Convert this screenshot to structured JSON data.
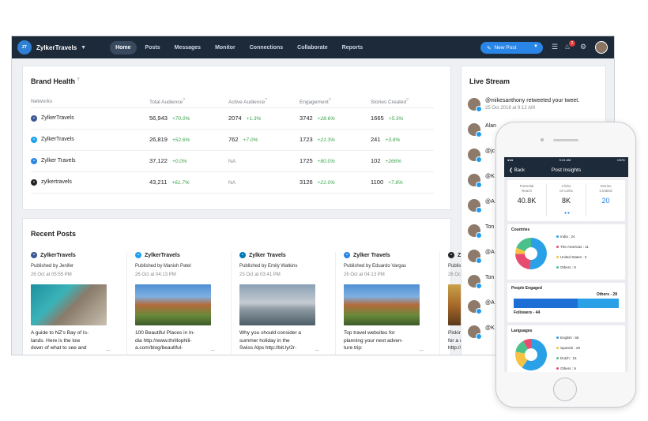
{
  "topbar": {
    "brand": "ZylkerTravels",
    "logo_text": "Zylker Travels",
    "nav": [
      "Home",
      "Posts",
      "Messages",
      "Monitor",
      "Connections",
      "Collaborate",
      "Reports"
    ],
    "active_nav": "Home",
    "new_post_label": "New Post",
    "notification_count": "2"
  },
  "brand_health": {
    "title": "Brand Health",
    "columns": [
      "Networks",
      "Total Audience",
      "Active Audience",
      "Engagement",
      "Stories Created"
    ],
    "rows": [
      {
        "network": "ZylkerTravels",
        "icon": "facebook-icon",
        "color": "#3b5998",
        "total": "56,943",
        "total_pct": "+70.0%",
        "active": "2074",
        "active_pct": "+1.3%",
        "eng": "3742",
        "eng_pct": "+28.6%",
        "stories": "1665",
        "stories_pct": "+5.3%"
      },
      {
        "network": "ZylkerTravels",
        "icon": "twitter-icon",
        "color": "#1da1f2",
        "total": "26,819",
        "total_pct": "+52.6%",
        "active": "762",
        "active_pct": "+7.0%",
        "eng": "1723",
        "eng_pct": "+21.3%",
        "stories": "241",
        "stories_pct": "+3.8%"
      },
      {
        "network": "Zylker Travels",
        "icon": "business-icon",
        "color": "#2a86e6",
        "total": "37,122",
        "total_pct": "+0.0%",
        "active": "NA",
        "active_pct": "",
        "eng": "1725",
        "eng_pct": "+80.0%",
        "stories": "102",
        "stories_pct": "+266%"
      },
      {
        "network": "zylkertravels",
        "icon": "instagram-icon",
        "color": "#222222",
        "total": "43,211",
        "total_pct": "+61.7%",
        "active": "NA",
        "active_pct": "",
        "eng": "3126",
        "eng_pct": "+21.0%",
        "stories": "1100",
        "stories_pct": "+7.8%"
      }
    ]
  },
  "recent_posts": {
    "title": "Recent Posts",
    "posts": [
      {
        "account": "ZylkerTravels",
        "icon": "facebook-icon",
        "color": "#3b5998",
        "published_by": "Published by Jenifer",
        "date": "26 Oct at 05:55 PM",
        "text": "A guide to NZ's Bay of Is-\nlands. Here is the low\ndown of what to see and",
        "img": "aerial"
      },
      {
        "account": "ZylkerTravels",
        "icon": "twitter-icon",
        "color": "#1da1f2",
        "published_by": "Published by Manish Patel",
        "date": "26 Oct at 04:13 PM",
        "text": "100 Beautiful Places in In-\ndia http://www.thrillophili-\na.com/blog/beautiful-",
        "img": "mountain"
      },
      {
        "account": "Zylker Travels",
        "icon": "linkedin-icon",
        "color": "#0077b5",
        "published_by": "Published by Emily Watkins",
        "date": "23 Oct at 03:41 PM",
        "text": "Why you should consider a\nsummer holiday in the\nSwiss Alps http://bit.ly/2r-",
        "img": "taj"
      },
      {
        "account": "Zylker Travels",
        "icon": "business-icon",
        "color": "#2a86e6",
        "published_by": "Published by Eduardo Vargas",
        "date": "26 Oct at 04:13 PM",
        "text": "Top travel websites for\nplanning your next adven-\nture trip:",
        "img": "mountain"
      },
      {
        "account": "Zylker T",
        "icon": "instagram-icon",
        "color": "#222222",
        "published_by": "Published by",
        "date": "26 Oct at",
        "text": "Picking the\nfor a classic\nhttp://bit.ly",
        "img": "forest"
      }
    ]
  },
  "live_stream": {
    "title": "Live Stream",
    "items": [
      {
        "text": "@mikesanthony retweeted your tweet.",
        "date": "25 Oct 2018 at 9:12 AM"
      },
      {
        "text": "Alan",
        "date": ""
      },
      {
        "text": "@jc",
        "date": ""
      },
      {
        "text": "@K",
        "date": ""
      },
      {
        "text": "@A",
        "date": ""
      },
      {
        "text": "Ton",
        "date": ""
      },
      {
        "text": "@A",
        "date": ""
      },
      {
        "text": "Ton",
        "date": ""
      },
      {
        "text": "@A",
        "date": ""
      },
      {
        "text": "@K",
        "date": ""
      }
    ]
  },
  "phone": {
    "status_time": "9:41 AM",
    "status_battery": "100%",
    "back_label": "Back",
    "title": "Post Insights",
    "metrics": [
      {
        "label": "Potential\nReach",
        "value": "40.8K"
      },
      {
        "label": "Clicks\non Links",
        "value": "8K"
      },
      {
        "label": "Stories\nCreated",
        "value": "20"
      }
    ],
    "countries_title": "Countries",
    "countries": [
      {
        "label": "India : 24",
        "color": "#2aa1e6",
        "share": 24
      },
      {
        "label": "The Americas : 11",
        "color": "#e64c6f",
        "share": 11
      },
      {
        "label": "United States : 3",
        "color": "#f6c244",
        "share": 3
      },
      {
        "label": "Others : 9",
        "color": "#4cc08a",
        "share": 9
      }
    ],
    "engaged_title": "People Engaged",
    "engaged_others": "Others - 28",
    "engaged_followers": "Followers - 44",
    "followers_fraction": 0.61,
    "languages_title": "Languages",
    "languages": [
      {
        "label": "English : 65",
        "color": "#2aa1e6",
        "share": 65
      },
      {
        "label": "Spanish : 20",
        "color": "#f6c244",
        "share": 20
      },
      {
        "label": "Dutch : 15",
        "color": "#4cc08a",
        "share": 15
      },
      {
        "label": "Others : 9",
        "color": "#e64c6f",
        "share": 9
      }
    ]
  }
}
